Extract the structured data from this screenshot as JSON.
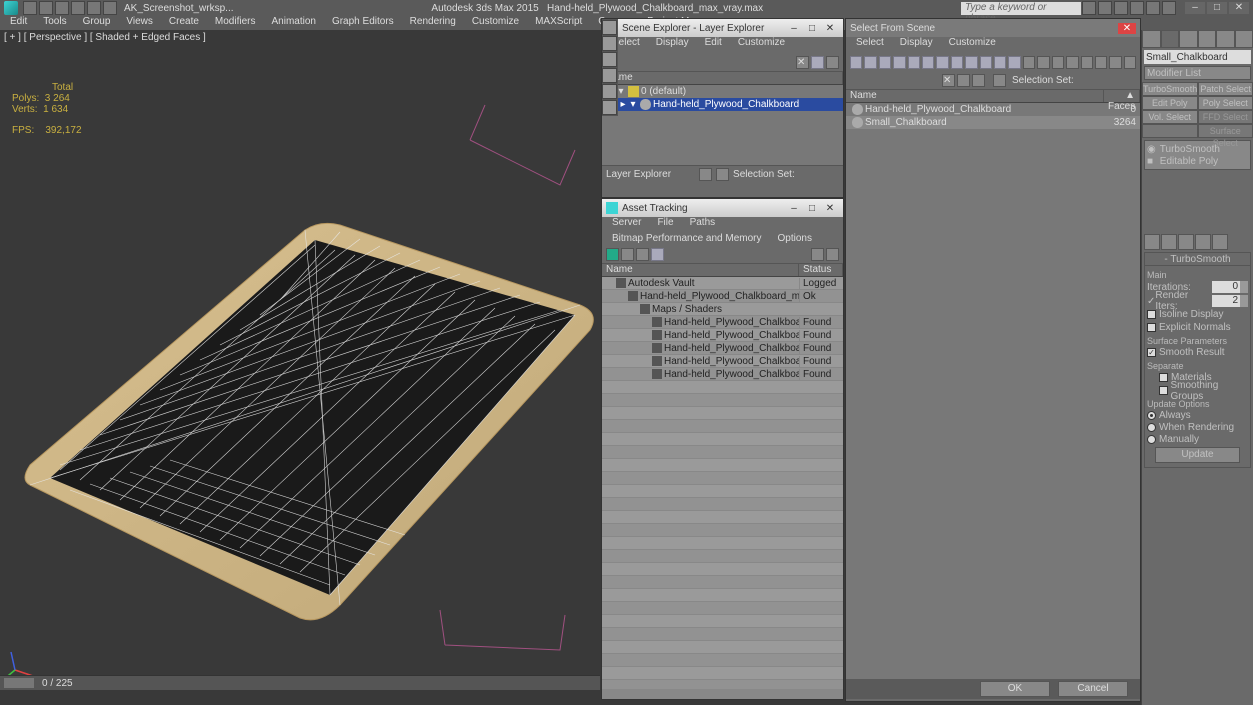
{
  "title": {
    "workspace": "AK_Screenshot_wrksp...",
    "app": "Autodesk 3ds Max 2015",
    "file": "Hand-held_Plywood_Chalkboard_max_vray.max",
    "search_placeholder": "Type a keyword or phrase"
  },
  "menu": [
    "Edit",
    "Tools",
    "Group",
    "Views",
    "Create",
    "Modifiers",
    "Animation",
    "Graph Editors",
    "Rendering",
    "Customize",
    "MAXScript",
    "Corona",
    "Project Man"
  ],
  "viewport": {
    "label": "[ + ] [ Perspective ] [ Shaded + Edged Faces ]",
    "stats": {
      "total": "Total",
      "polys_lbl": "Polys:",
      "polys": "3 264",
      "verts_lbl": "Verts:",
      "verts": "1 634",
      "fps_lbl": "FPS:",
      "fps": "392,172"
    },
    "frame": "0 / 225"
  },
  "scene_explorer": {
    "title": "Scene Explorer - Layer Explorer",
    "menu": [
      "Select",
      "Display",
      "Edit",
      "Customize"
    ],
    "col": "Name",
    "rows": [
      {
        "label": "0 (default)",
        "indent": 1,
        "sel": false
      },
      {
        "label": "Hand-held_Plywood_Chalkboard",
        "indent": 2,
        "sel": true
      }
    ],
    "bottom_label": "Layer Explorer",
    "selset": "Selection Set:"
  },
  "asset_tracking": {
    "title": "Asset Tracking",
    "menu": [
      "Server",
      "File",
      "Paths",
      "Bitmap Performance and Memory",
      "Options"
    ],
    "col_name": "Name",
    "col_status": "Status",
    "rows": [
      {
        "name": "Autodesk Vault",
        "status": "Logged",
        "indent": 1
      },
      {
        "name": "Hand-held_Plywood_Chalkboard_max_vray.max",
        "status": "Ok",
        "indent": 2
      },
      {
        "name": "Maps / Shaders",
        "status": "",
        "indent": 3
      },
      {
        "name": "Hand-held_Plywood_Chalkboard_Diffuse...",
        "status": "Found",
        "indent": 4
      },
      {
        "name": "Hand-held_Plywood_Chalkboard_Fresnel...",
        "status": "Found",
        "indent": 4
      },
      {
        "name": "Hand-held_Plywood_Chalkboard_Glossin...",
        "status": "Found",
        "indent": 4
      },
      {
        "name": "Hand-held_Plywood_Chalkboard_Normal...",
        "status": "Found",
        "indent": 4
      },
      {
        "name": "Hand-held_Plywood_Chalkboard_Specula...",
        "status": "Found",
        "indent": 4
      }
    ]
  },
  "select_from_scene": {
    "title": "Select From Scene",
    "menu": [
      "Select",
      "Display",
      "Customize"
    ],
    "col_name": "Name",
    "col_faces": "Faces",
    "selset": "Selection Set:",
    "rows": [
      {
        "name": "Hand-held_Plywood_Chalkboard",
        "faces": "0",
        "sel": false
      },
      {
        "name": "Small_Chalkboard",
        "faces": "3264",
        "sel": true
      }
    ],
    "ok": "OK",
    "cancel": "Cancel"
  },
  "cmd": {
    "objname": "Small_Chalkboard",
    "modlist": "Modifier List",
    "sel_btns": [
      "TurboSmooth",
      "Patch Select",
      "Edit Poly",
      "Poly Select",
      "Vol. Select",
      "FFD Select",
      "",
      "Surface Select"
    ],
    "stack": [
      "TurboSmooth",
      "Editable Poly"
    ],
    "turbosmooth": {
      "hdr": "TurboSmooth",
      "main": "Main",
      "iterations_lbl": "Iterations:",
      "iterations": "0",
      "render_iters_lbl": "Render Iters:",
      "render_iters": "2",
      "isoline": "Isoline Display",
      "explicit": "Explicit Normals",
      "surface_params": "Surface Parameters",
      "smooth_result": "Smooth Result",
      "separate": "Separate",
      "materials": "Materials",
      "smoothing_groups": "Smoothing Groups",
      "update_options": "Update Options",
      "always": "Always",
      "when_rendering": "When Rendering",
      "manually": "Manually",
      "update": "Update"
    }
  }
}
